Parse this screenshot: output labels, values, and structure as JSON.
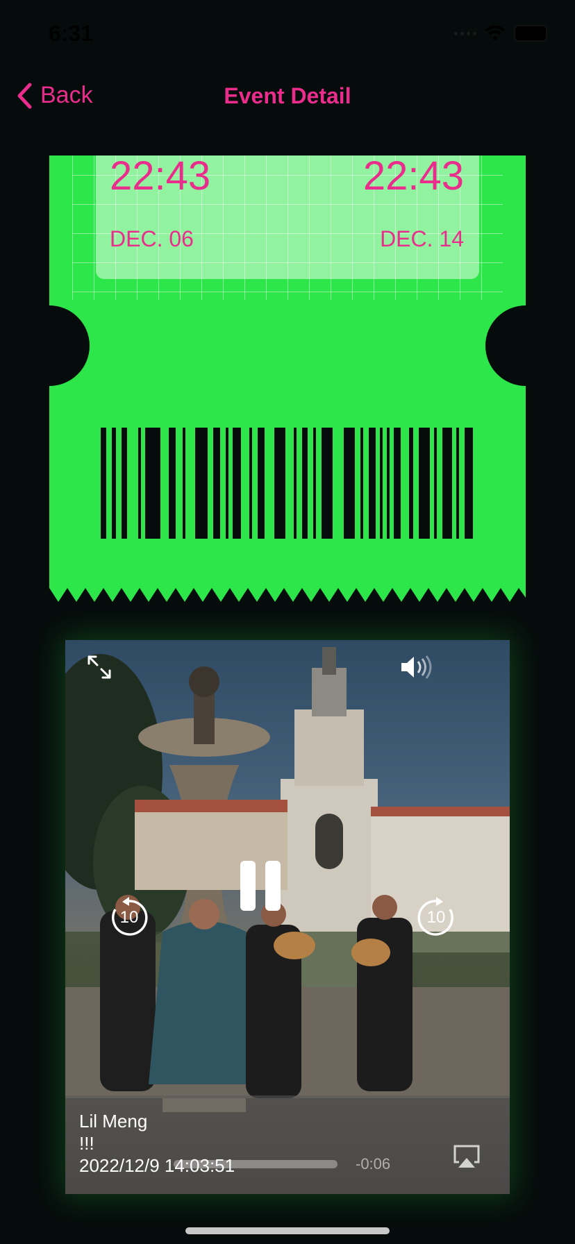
{
  "status_bar": {
    "time": "6:31"
  },
  "nav": {
    "back_label": "Back",
    "title": "Event Detail"
  },
  "ticket": {
    "start_time": "22:43",
    "end_time": "22:43",
    "start_date": "DEC. 06",
    "end_date": "DEC. 14",
    "colors": {
      "ticket": "#2de64a",
      "accent": "#ea2d8c"
    }
  },
  "video": {
    "icons": [
      "expand-icon",
      "volume-icon",
      "rewind-10-icon",
      "pause-icon",
      "forward-10-icon",
      "airplay-icon"
    ],
    "skip_back_label": "10",
    "skip_forward_label": "10",
    "caption_name": "Lil Meng",
    "caption_text": "!!!",
    "caption_timestamp": "2022/12/9 14:03:51",
    "remaining_time": "-0:06",
    "progress": 0.0
  }
}
